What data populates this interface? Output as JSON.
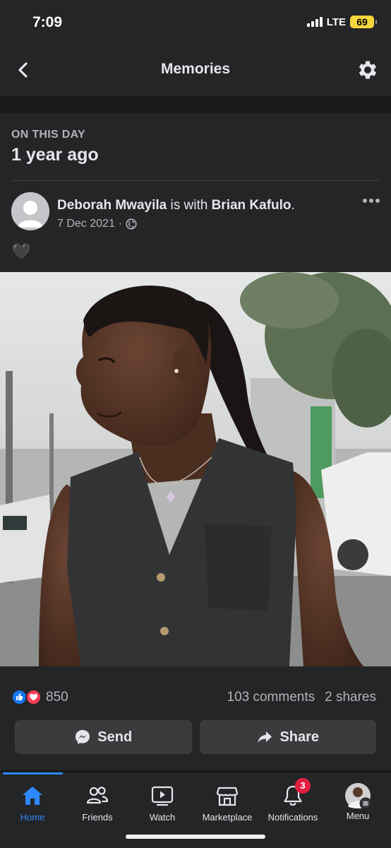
{
  "status_bar": {
    "time": "7:09",
    "network": "LTE",
    "battery": "69",
    "battery_color": "#f5d63d"
  },
  "header": {
    "title": "Memories",
    "back_icon": "chevron-left-icon",
    "settings_icon": "gear-icon"
  },
  "memory": {
    "section_label": "ON THIS DAY",
    "period": "1 year ago"
  },
  "post": {
    "author": "Deborah Mwayila",
    "connector": " is with ",
    "tagged": "Brian Kafulo",
    "tagged_suffix": ".",
    "date": "7 Dec 2021",
    "date_separator": "·",
    "privacy_icon": "globe-icon",
    "caption": "🖤",
    "photo_alt": "Woman in a dark sleeveless top with a ponytail, looking to the side"
  },
  "engagement": {
    "reaction_count": "850",
    "comments": "103 comments",
    "shares": "2 shares",
    "like_color": "#1877f2",
    "love_color": "#f33e58"
  },
  "actions": {
    "send_label": "Send",
    "share_label": "Share"
  },
  "tabs": [
    {
      "label": "Home",
      "icon": "home-icon",
      "active": true
    },
    {
      "label": "Friends",
      "icon": "friends-icon",
      "active": false
    },
    {
      "label": "Watch",
      "icon": "watch-icon",
      "active": false
    },
    {
      "label": "Marketplace",
      "icon": "marketplace-icon",
      "active": false
    },
    {
      "label": "Notifications",
      "icon": "bell-icon",
      "badge": "3",
      "active": false
    },
    {
      "label": "Menu",
      "icon": "menu-avatar-icon",
      "active": false
    }
  ],
  "accent_color": "#2d88ff"
}
